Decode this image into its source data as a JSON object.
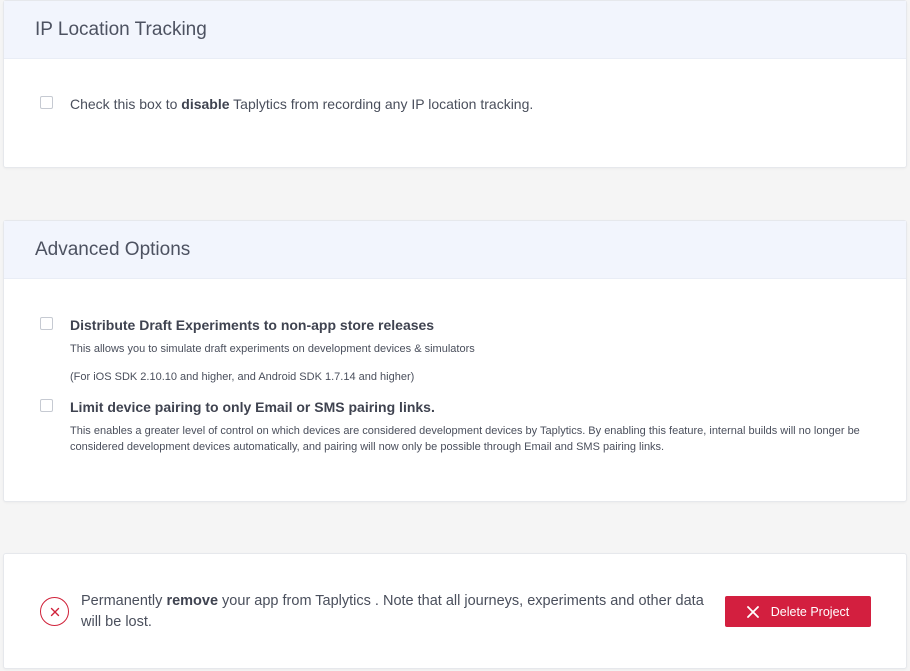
{
  "ip_tracking": {
    "title": "IP Location Tracking",
    "text_before": "Check this box to ",
    "text_bold": "disable",
    "text_after": " Taplytics from recording any IP location tracking.",
    "checked": false
  },
  "advanced": {
    "title": "Advanced Options",
    "options": [
      {
        "title": "Distribute Draft Experiments to non-app store releases",
        "description": "This allows you to simulate draft experiments on development devices & simulators",
        "note": "(For iOS SDK 2.10.10 and higher, and Android SDK 1.7.14 and higher)",
        "checked": false
      },
      {
        "title": "Limit device pairing to only Email or SMS pairing links.",
        "description": "This enables a greater level of control on which devices are considered development devices by Taplytics. By enabling this feature, internal builds will no longer be considered development devices automatically, and pairing will now only be possible through Email and SMS pairing links.",
        "checked": false
      }
    ]
  },
  "danger": {
    "text_before": "Permanently ",
    "text_bold": "remove",
    "text_after": " your app from Taplytics . Note that all journeys, experiments and other data will be lost.",
    "button_label": "Delete Project",
    "accent_color": "#d31f3f"
  }
}
